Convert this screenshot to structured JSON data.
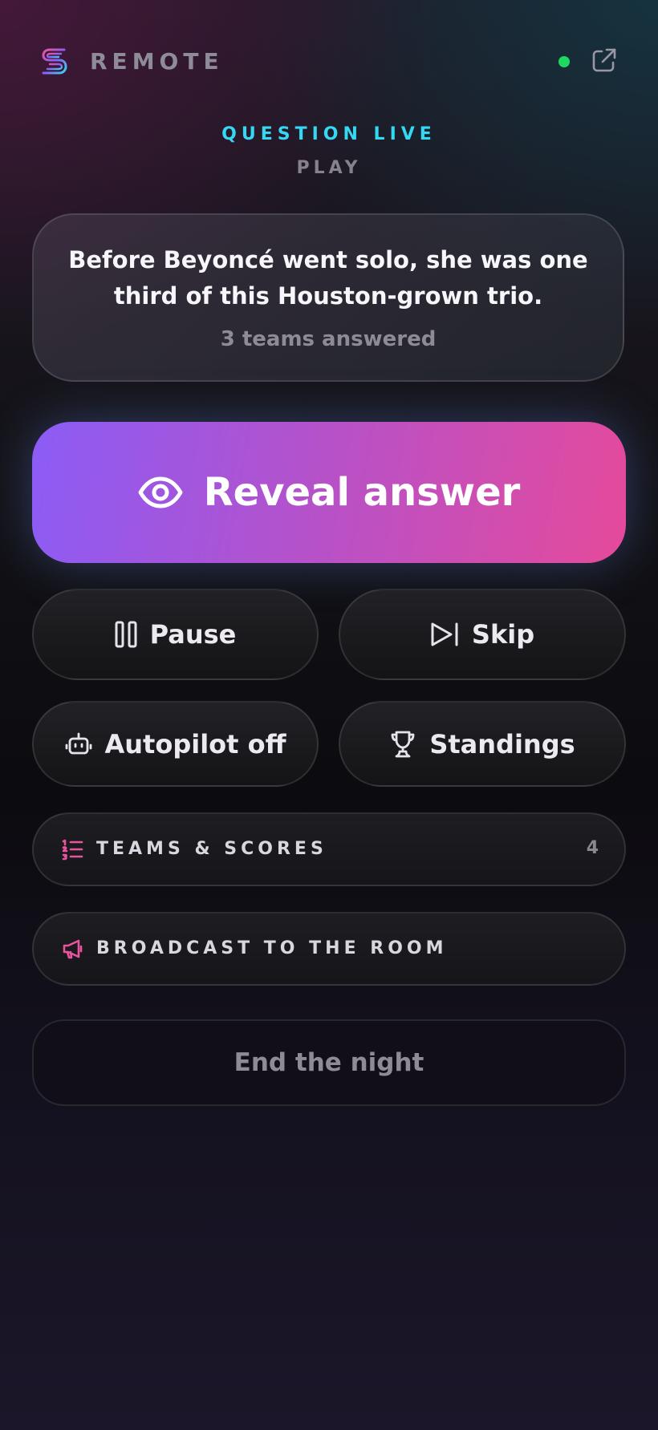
{
  "header": {
    "brand": "REMOTE"
  },
  "status": {
    "state": "QUESTION LIVE",
    "mode": "PLAY"
  },
  "question": {
    "text": "Before Beyoncé went solo, she was one third of this Houston-grown trio.",
    "answered": "3 teams answered"
  },
  "actions": {
    "reveal_label": "Reveal answer",
    "pause_label": "Pause",
    "skip_label": "Skip",
    "autopilot_label": "Autopilot off",
    "standings_label": "Standings"
  },
  "sections": {
    "teams_label": "TEAMS & SCORES",
    "teams_count": "4",
    "broadcast_label": "BROADCAST TO THE ROOM"
  },
  "footer": {
    "end_label": "End the night"
  },
  "colors": {
    "accent_cyan": "#35d8f2",
    "live_green": "#1ed760",
    "gradient_start": "#8b5cf6",
    "gradient_end": "#e54a9b",
    "icon_pink": "#e8559e"
  }
}
